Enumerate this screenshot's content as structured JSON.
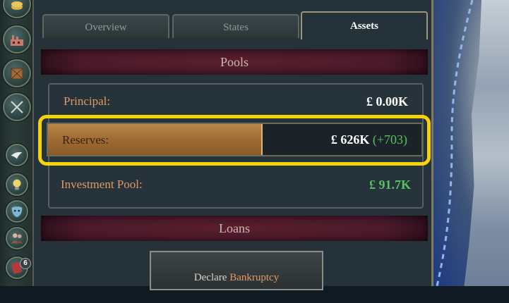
{
  "sidebar": {
    "icons": [
      "coins-icon",
      "factory-icon",
      "crate-icon",
      "crossed-swords-icon",
      "dove-icon",
      "lightbulb-icon",
      "mask-icon",
      "people-icon",
      "book-icon"
    ],
    "badge_count": "6"
  },
  "tabs": [
    {
      "label": "Overview",
      "active": false
    },
    {
      "label": "States",
      "active": false
    },
    {
      "label": "Assets",
      "active": true
    }
  ],
  "pools": {
    "header": "Pools",
    "principal": {
      "label": "Principal:",
      "value": "£ 0.00K"
    },
    "reserves": {
      "label": "Reserves:",
      "value": "£ 626K",
      "change": "(+703)",
      "fill_percent": 57
    },
    "investment_pool": {
      "label": "Investment Pool:",
      "value": "£ 91.7K"
    }
  },
  "loans": {
    "header": "Loans",
    "declare_prefix": "Declare",
    "declare_word": "Bankruptcy"
  },
  "colors": {
    "accent_orange": "#e09a62",
    "highlight_yellow": "#f5d20a",
    "positive_green": "#59c163",
    "header_maroon": "#48182a"
  }
}
